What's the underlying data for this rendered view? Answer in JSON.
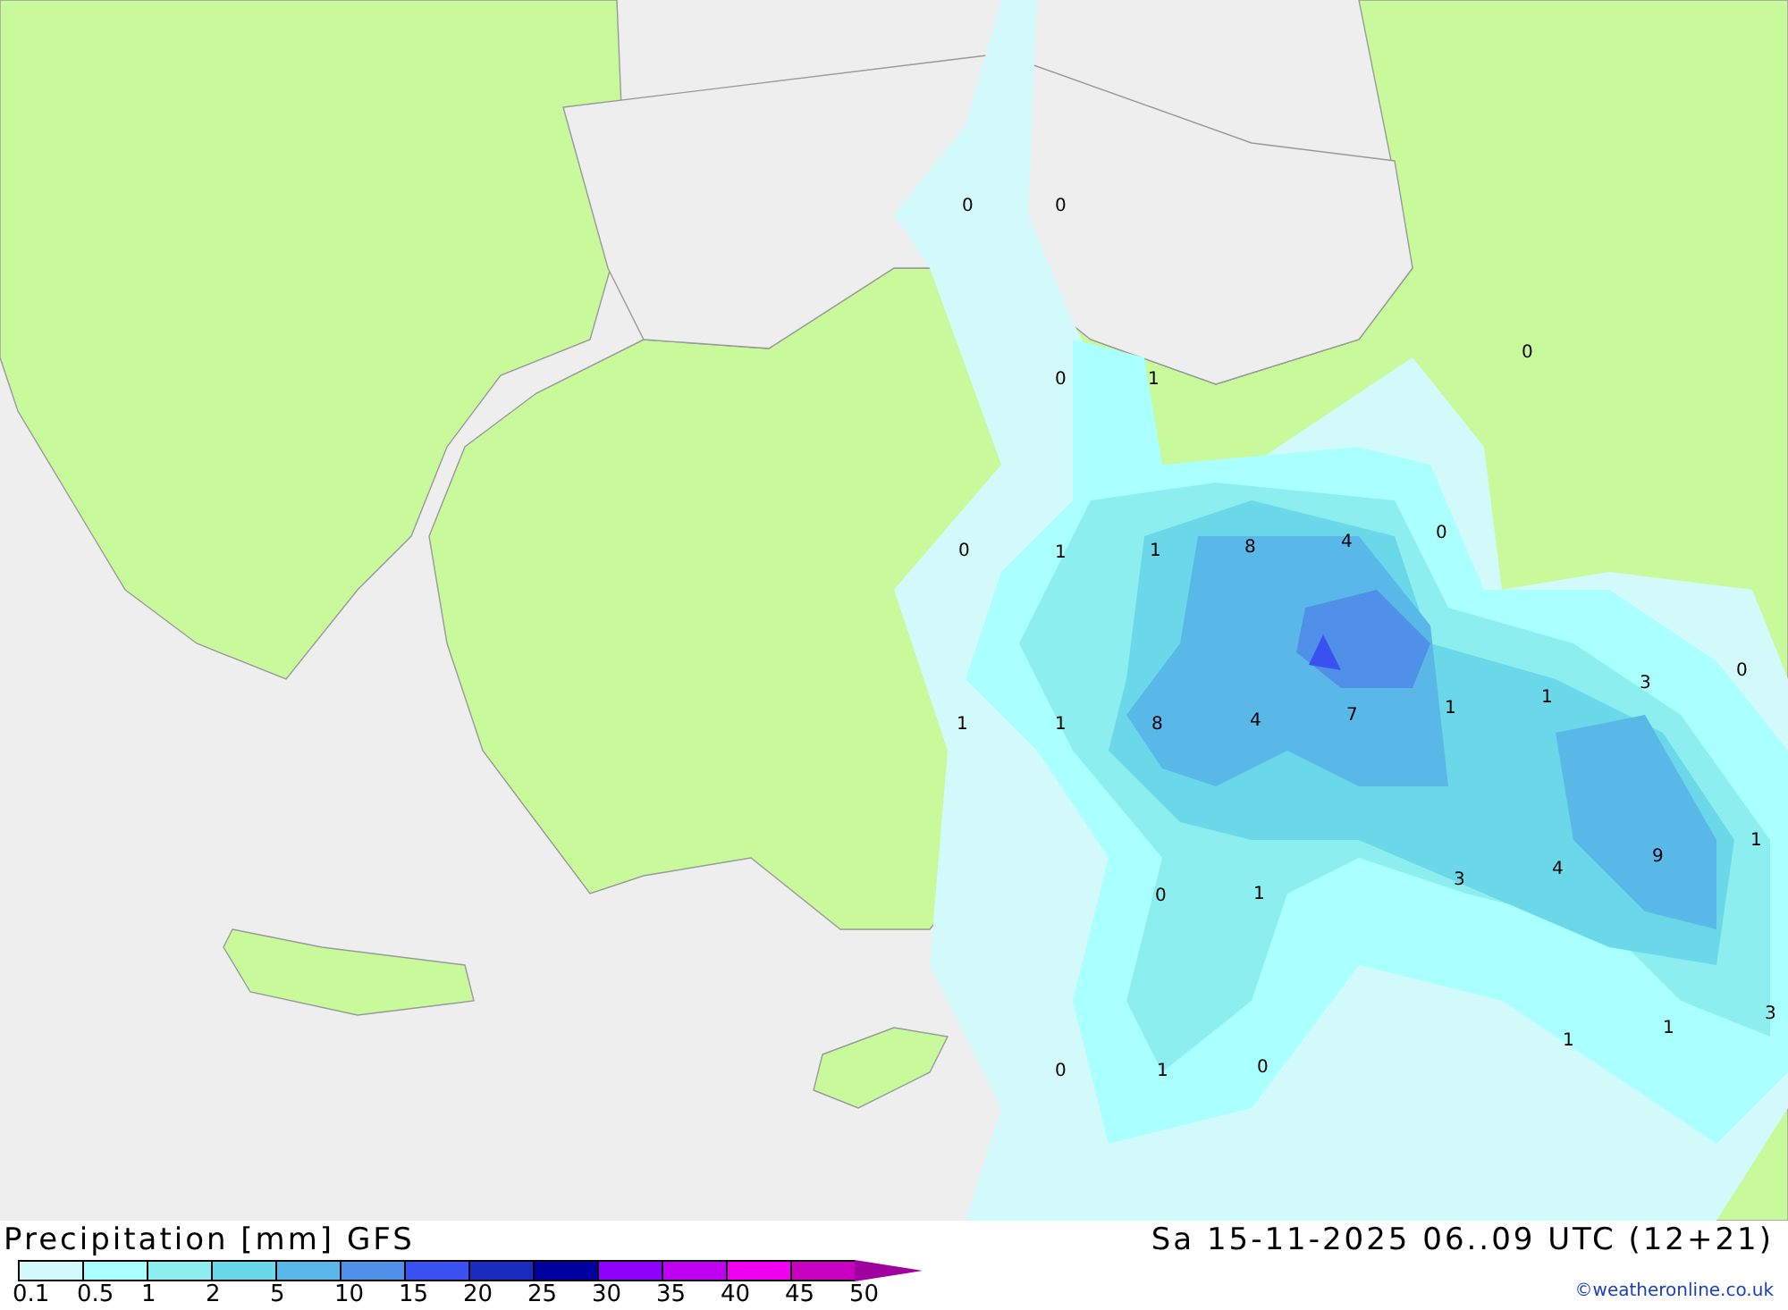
{
  "map": {
    "value_labels": [
      "0",
      "0",
      "0",
      "0",
      "1",
      "0",
      "1",
      "1",
      "8",
      "4",
      "0",
      "1",
      "1",
      "8",
      "4",
      "7",
      "1",
      "1",
      "3",
      "0",
      "0",
      "1",
      "3",
      "4",
      "9",
      "1",
      "0",
      "1",
      "0",
      "1",
      "1",
      "3"
    ]
  },
  "title": "Precipitation [mm] GFS",
  "valid_time": "Sa 15-11-2025 06..09 UTC (12+21)",
  "legend": [
    {
      "label": "0.1",
      "color": "#d2fafa"
    },
    {
      "label": "0.5",
      "color": "#aaffff"
    },
    {
      "label": "1",
      "color": "#8ceeee"
    },
    {
      "label": "2",
      "color": "#6ad8e8"
    },
    {
      "label": "5",
      "color": "#5ab8e8"
    },
    {
      "label": "10",
      "color": "#5090e8"
    },
    {
      "label": "15",
      "color": "#3a50f0"
    },
    {
      "label": "20",
      "color": "#1a2cc0"
    },
    {
      "label": "25",
      "color": "#0000a0"
    },
    {
      "label": "30",
      "color": "#9000ff"
    },
    {
      "label": "35",
      "color": "#c000f0"
    },
    {
      "label": "40",
      "color": "#f000f0"
    },
    {
      "label": "45",
      "color": "#c800c0"
    },
    {
      "label": "50",
      "color": "#a000a0"
    }
  ],
  "credit": "©weatheronline.co.uk"
}
